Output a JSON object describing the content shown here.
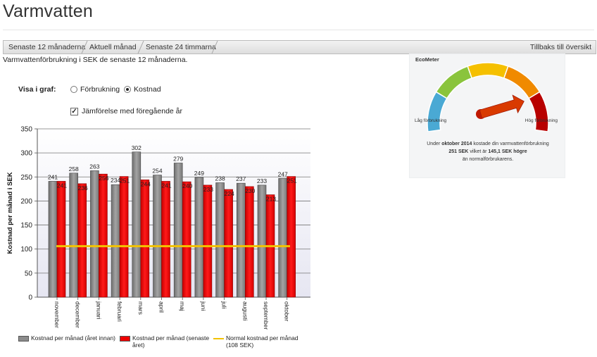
{
  "page": {
    "title": "Varmvatten"
  },
  "tabs": [
    {
      "label": "Senaste 12 månaderna"
    },
    {
      "label": "Aktuell månad"
    },
    {
      "label": "Senaste 24 timmarna"
    }
  ],
  "back_link": "Tillbaks till översikt",
  "description": "Varmvattenförbrukning i SEK de senaste 12 månaderna.",
  "controls": {
    "graph_label": "Visa i graf:",
    "options": [
      {
        "label": "Förbrukning",
        "checked": false
      },
      {
        "label": "Kostnad",
        "checked": true
      }
    ],
    "compare_label": "Jämförelse med föregående år",
    "compare_checked": true
  },
  "ecometer": {
    "title": "EcoMeter",
    "low_label": "Låg förbrukning",
    "high_label": "Hög förbrukning",
    "line1_pre": "Under ",
    "line1_bold": "oktober 2014",
    "line1_post": " kostade din varmvattenförbrukning",
    "line2_bold": "251 SEK",
    "line2_mid": " vilket är ",
    "line2_bold2": "145,1 SEK högre",
    "line3": "än normalförbrukarens.",
    "gauge_level": 0.8,
    "colors": [
      "#4aa9d4",
      "#8ac43c",
      "#f5c000",
      "#f08a00",
      "#b80000"
    ]
  },
  "chart_data": {
    "type": "bar",
    "categories": [
      "november",
      "december",
      "januari",
      "februari",
      "mars",
      "april",
      "maj",
      "juni",
      "juli",
      "augusti",
      "september",
      "oktober"
    ],
    "series": [
      {
        "name": "Kostnad per månad (året innan)",
        "values": [
          241,
          258,
          263,
          234,
          302,
          254,
          279,
          249,
          238,
          237,
          233,
          247
        ],
        "color": "#8c8c8c"
      },
      {
        "name": "Kostnad per månad (senaste året)",
        "values": [
          241,
          236,
          256,
          251,
          244,
          241,
          240,
          233,
          224,
          230,
          213,
          251
        ],
        "color": "#ee0000"
      }
    ],
    "labels": [
      [
        "241",
        "241"
      ],
      [
        "258",
        "236"
      ],
      [
        "263",
        "256"
      ],
      [
        "234",
        "251"
      ],
      [
        "302",
        "244"
      ],
      [
        "254",
        "241"
      ],
      [
        "279",
        "240"
      ],
      [
        "249",
        "233"
      ],
      [
        "238",
        "224"
      ],
      [
        "237",
        "230"
      ],
      [
        "233",
        "213"
      ],
      [
        "247",
        "251"
      ]
    ],
    "reference_line": {
      "name": "Normal kostnad per månad (108 SEK)",
      "value": 106,
      "color": "#f2c200"
    },
    "ylabel": "Kostnad per månad i SEK",
    "ylim": [
      0,
      350
    ],
    "yticks": [
      0,
      50,
      100,
      150,
      200,
      250,
      300,
      350
    ],
    "grid": true,
    "legend_position": "bottom"
  }
}
